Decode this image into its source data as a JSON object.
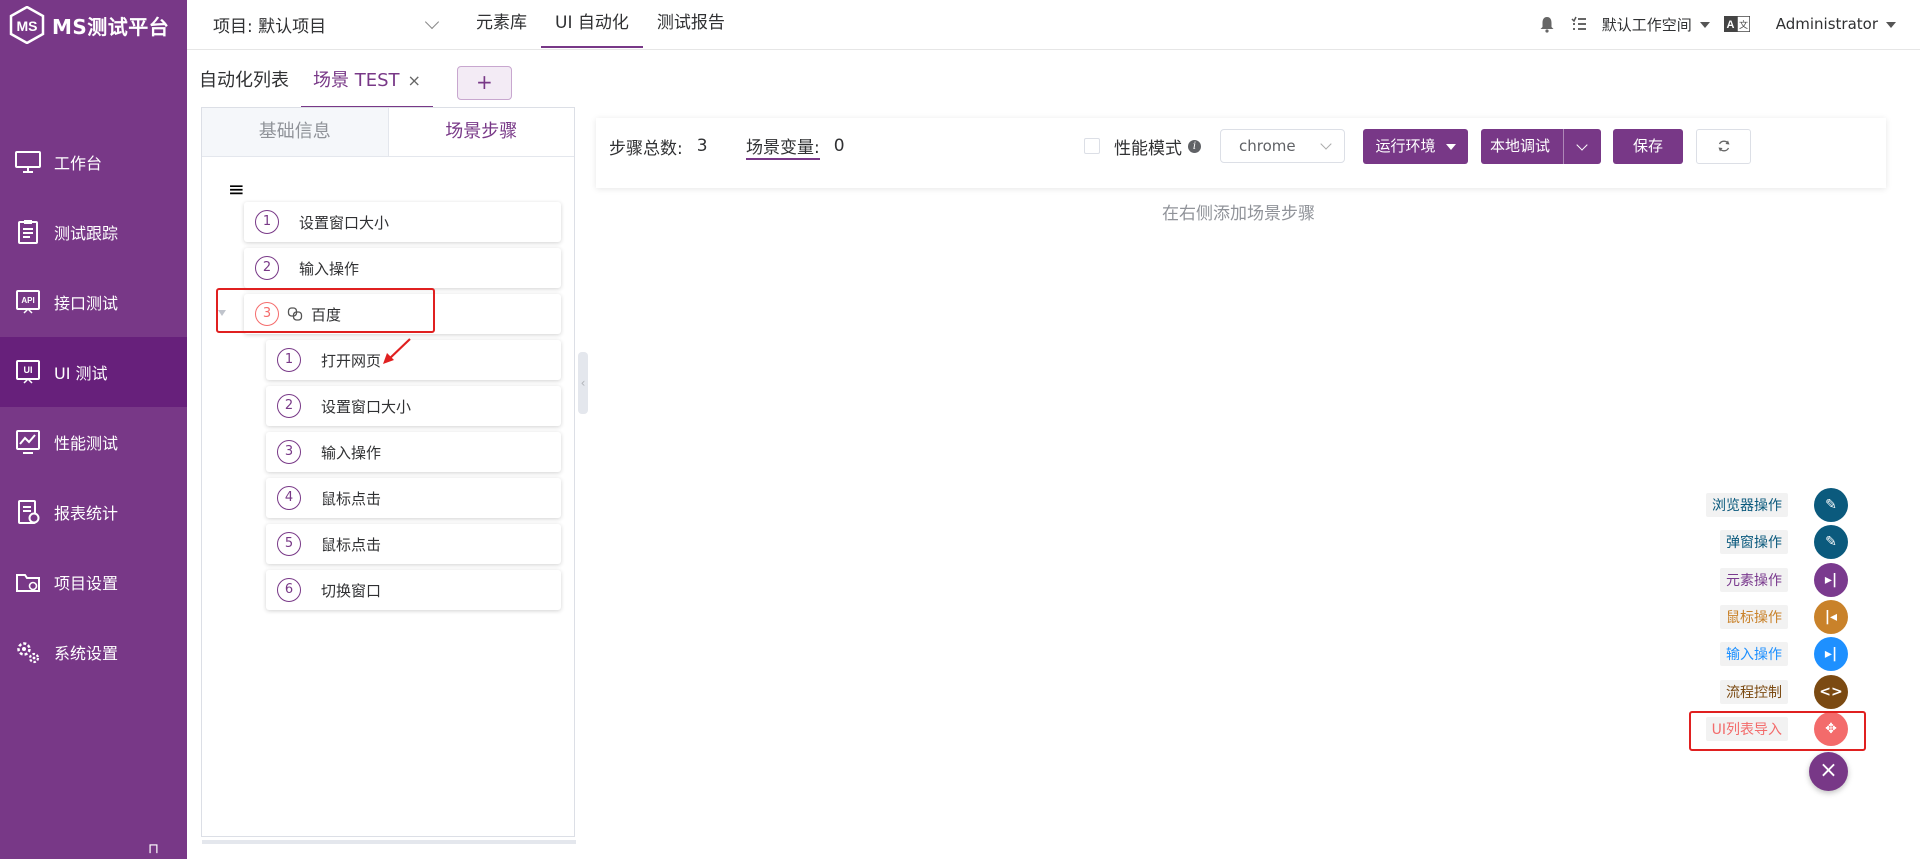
{
  "app": {
    "logo_text": "MS测试平台",
    "logo_letters": "MS"
  },
  "sidebar": {
    "items": [
      {
        "label": "工作台",
        "icon": "monitor-icon",
        "active": false
      },
      {
        "label": "测试跟踪",
        "icon": "clipboard-icon",
        "active": false
      },
      {
        "label": "接口测试",
        "icon": "api-icon",
        "active": false
      },
      {
        "label": "UI 测试",
        "icon": "ui-icon",
        "active": true
      },
      {
        "label": "性能测试",
        "icon": "chart-icon",
        "active": false
      },
      {
        "label": "报表统计",
        "icon": "report-icon",
        "active": false
      },
      {
        "label": "项目设置",
        "icon": "folder-icon",
        "active": false
      },
      {
        "label": "系统设置",
        "icon": "gears-icon",
        "active": false
      }
    ]
  },
  "header": {
    "project": "项目: 默认项目",
    "nav": [
      "元素库",
      "UI 自动化",
      "测试报告"
    ],
    "active_nav": 1,
    "workspace": "默认工作空间",
    "user": "Administrator"
  },
  "tabs": {
    "list_label": "自动化列表",
    "scenario_label": "场景 TEST",
    "close": "×",
    "add": "+"
  },
  "left_panel": {
    "tab_basic": "基础信息",
    "tab_steps": "场景步骤",
    "steps": [
      {
        "num": "1",
        "label": "设置窗口大小"
      },
      {
        "num": "2",
        "label": "输入操作"
      },
      {
        "num": "3",
        "label": "百度"
      }
    ],
    "children": [
      {
        "num": "1",
        "label": "打开网页"
      },
      {
        "num": "2",
        "label": "设置窗口大小"
      },
      {
        "num": "3",
        "label": "输入操作"
      },
      {
        "num": "4",
        "label": "鼠标点击"
      },
      {
        "num": "5",
        "label": "鼠标点击"
      },
      {
        "num": "6",
        "label": "切换窗口"
      }
    ]
  },
  "toolbar": {
    "total_label": "步骤总数:",
    "total_value": "3",
    "var_label": "场景变量:",
    "var_value": "0",
    "perf_mode": "性能模式",
    "browser": "chrome",
    "env_button": "运行环境",
    "debug_button": "本地调试",
    "save_button": "保存"
  },
  "hint": "在右侧添加场景步骤",
  "fab": {
    "items": [
      {
        "label": "浏览器操作",
        "color": "#0b5a7d",
        "text_color": "#0b5a7d",
        "glyph": "✎"
      },
      {
        "label": "弹窗操作",
        "color": "#0b5a7d",
        "text_color": "#0b5a7d",
        "glyph": "✎"
      },
      {
        "label": "元素操作",
        "color": "#7a3a8e",
        "text_color": "#7a3a8e",
        "glyph": "▸|"
      },
      {
        "label": "鼠标操作",
        "color": "#c9822a",
        "text_color": "#c9822a",
        "glyph": "|◂"
      },
      {
        "label": "输入操作",
        "color": "#1e90ff",
        "text_color": "#1e90ff",
        "glyph": "▸|"
      },
      {
        "label": "流程控制",
        "color": "#7b4a12",
        "text_color": "#7b4a12",
        "glyph": "<>"
      },
      {
        "label": "UI列表导入",
        "color": "#f36b6b",
        "text_color": "#f36b6b",
        "glyph": "✥"
      }
    ],
    "close": "×"
  }
}
